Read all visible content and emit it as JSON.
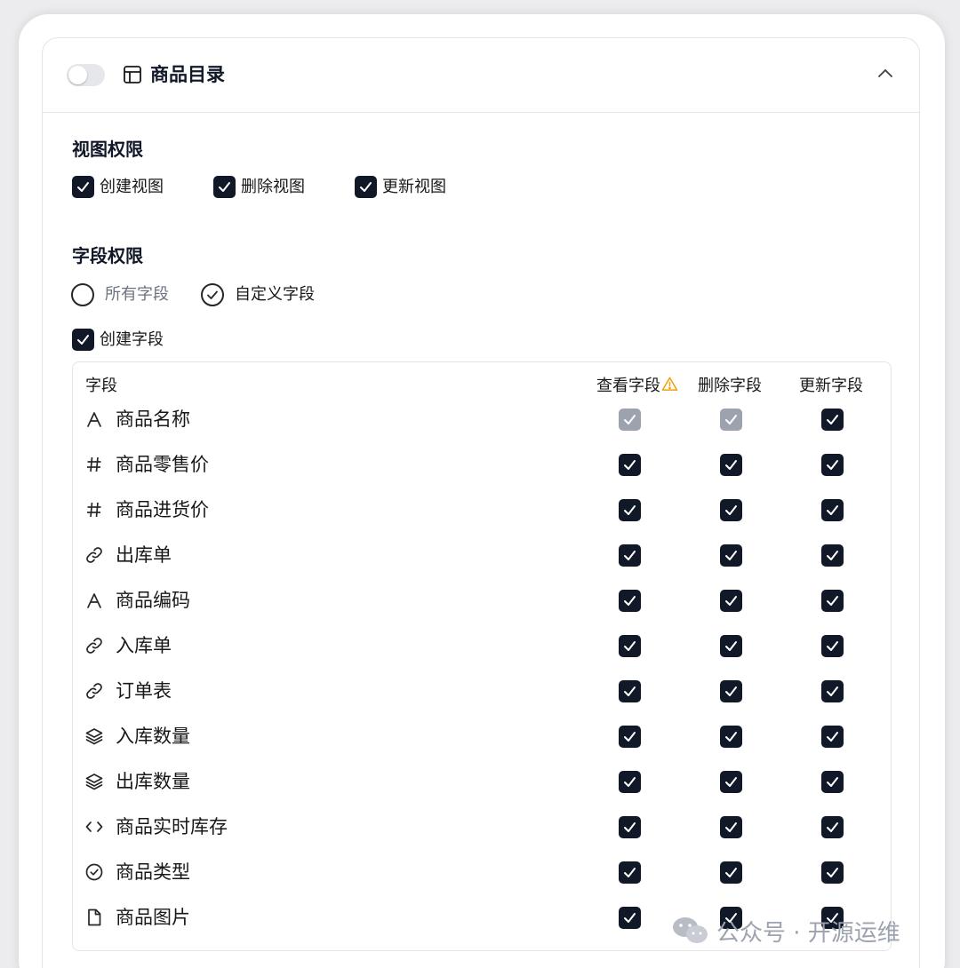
{
  "header": {
    "title": "商品目录",
    "toggle_on": false
  },
  "view_permissions": {
    "title": "视图权限",
    "options": [
      {
        "label": "创建视图",
        "checked": true
      },
      {
        "label": "删除视图",
        "checked": true
      },
      {
        "label": "更新视图",
        "checked": true
      }
    ]
  },
  "field_permissions": {
    "title": "字段权限",
    "radio_all": {
      "label": "所有字段",
      "selected": false
    },
    "radio_custom": {
      "label": "自定义字段",
      "selected": true
    },
    "create_field": {
      "label": "创建字段",
      "checked": true
    }
  },
  "table": {
    "columns": {
      "field": "字段",
      "view": "查看字段",
      "delete": "删除字段",
      "update": "更新字段"
    },
    "rows": [
      {
        "icon": "text-type-icon",
        "name": "商品名称",
        "view": "disabled-checked",
        "delete": "disabled-checked",
        "update": "checked"
      },
      {
        "icon": "number-hash-icon",
        "name": "商品零售价",
        "view": "checked",
        "delete": "checked",
        "update": "checked"
      },
      {
        "icon": "number-hash-icon",
        "name": "商品进货价",
        "view": "checked",
        "delete": "checked",
        "update": "checked"
      },
      {
        "icon": "link-icon",
        "name": "出库单",
        "view": "checked",
        "delete": "checked",
        "update": "checked"
      },
      {
        "icon": "text-type-icon",
        "name": "商品编码",
        "view": "checked",
        "delete": "checked",
        "update": "checked"
      },
      {
        "icon": "link-icon",
        "name": "入库单",
        "view": "checked",
        "delete": "checked",
        "update": "checked"
      },
      {
        "icon": "link-icon",
        "name": "订单表",
        "view": "checked",
        "delete": "checked",
        "update": "checked"
      },
      {
        "icon": "layers-icon",
        "name": "入库数量",
        "view": "checked",
        "delete": "checked",
        "update": "checked"
      },
      {
        "icon": "layers-icon",
        "name": "出库数量",
        "view": "checked",
        "delete": "checked",
        "update": "checked"
      },
      {
        "icon": "code-icon",
        "name": "商品实时库存",
        "view": "checked",
        "delete": "checked",
        "update": "checked"
      },
      {
        "icon": "circle-check-icon",
        "name": "商品类型",
        "view": "checked",
        "delete": "checked",
        "update": "checked"
      },
      {
        "icon": "file-icon",
        "name": "商品图片",
        "view": "checked",
        "delete": "checked",
        "update": "checked"
      }
    ]
  },
  "watermark": {
    "text": "公众号 · 开源运维"
  },
  "colors": {
    "checkbox": "#111827",
    "checkbox_disabled": "#9ca3af",
    "warning": "#f59e0b"
  }
}
